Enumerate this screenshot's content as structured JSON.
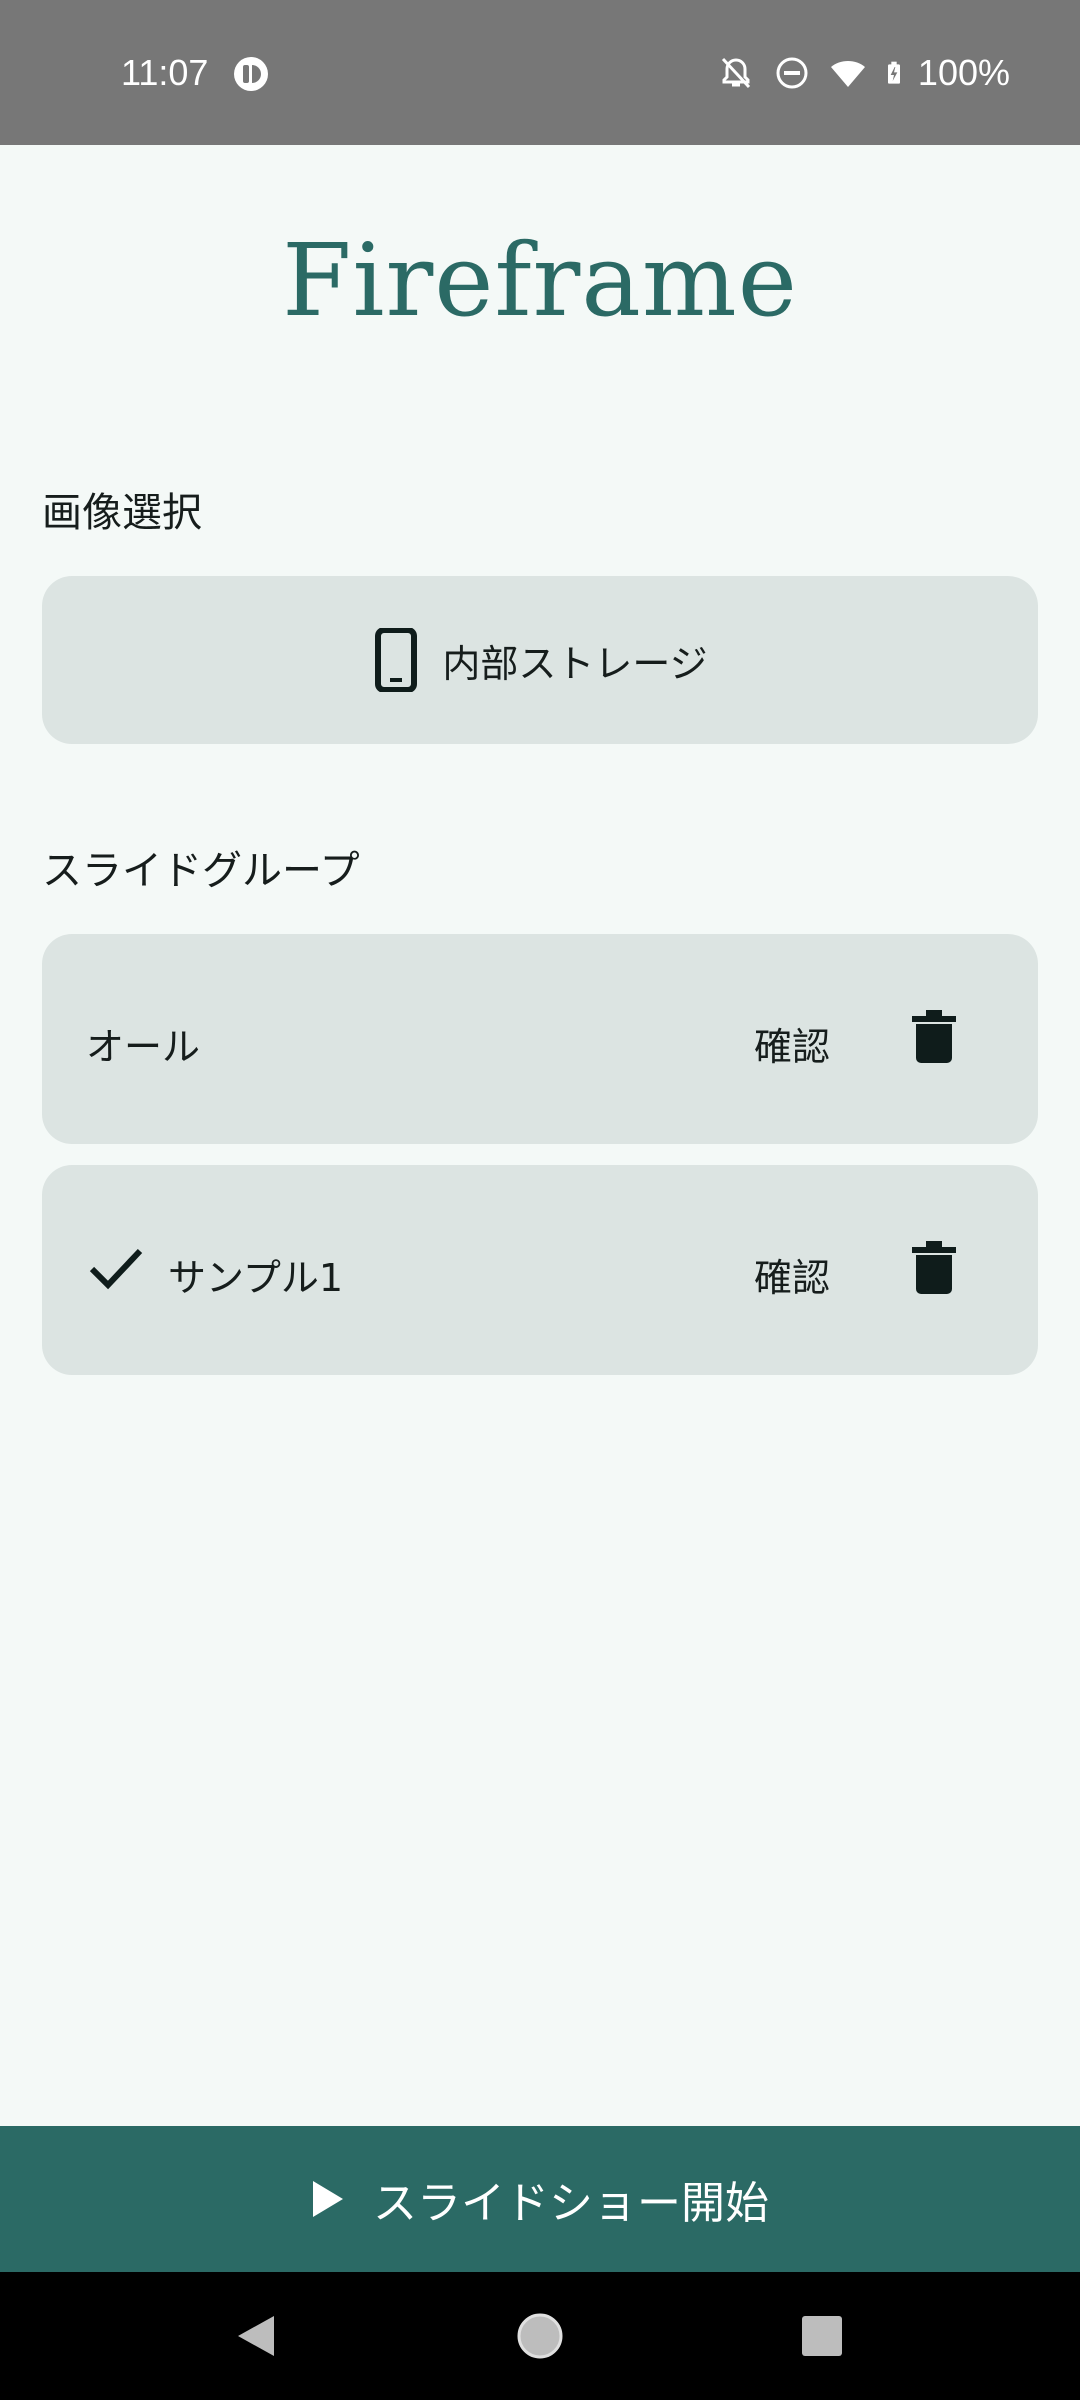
{
  "status_bar": {
    "time": "11:07",
    "battery": "100%",
    "icons": [
      "app-notification-icon",
      "bell-off-icon",
      "do-not-disturb-icon",
      "wifi-icon",
      "battery-charging-icon"
    ]
  },
  "app": {
    "title": "Fireframe"
  },
  "image_select": {
    "label": "画像選択",
    "storage_button": "内部ストレージ",
    "storage_icon": "phone-icon"
  },
  "slide_groups": {
    "label": "スライドグループ",
    "items": [
      {
        "name": "オール",
        "selected": false,
        "confirm_label": "確認",
        "delete_icon": "trash-icon"
      },
      {
        "name": "サンプル1",
        "selected": true,
        "confirm_label": "確認",
        "delete_icon": "trash-icon"
      }
    ]
  },
  "bottom_action": {
    "label": "スライドショー開始",
    "icon": "play-icon"
  },
  "colors": {
    "accent": "#2b6a65",
    "background": "#f4f9f7",
    "card": "#dce4e2",
    "status_bar": "#777777"
  }
}
